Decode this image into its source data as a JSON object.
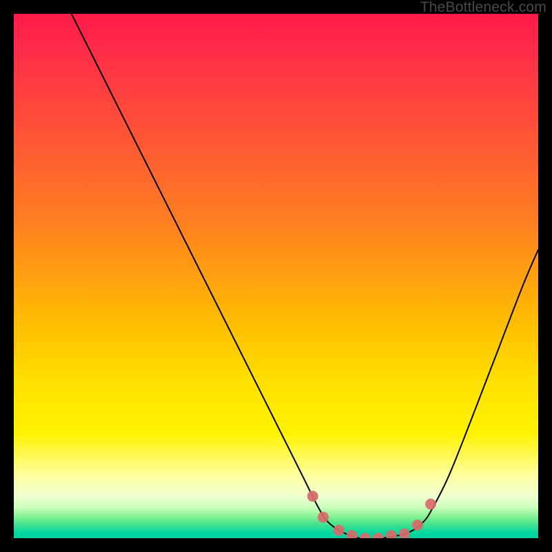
{
  "attribution": "TheBottleneck.com",
  "chart_data": {
    "type": "line",
    "title": "",
    "xlabel": "",
    "ylabel": "",
    "xlim": [
      0,
      100
    ],
    "ylim": [
      0,
      100
    ],
    "grid": false,
    "background_gradient": {
      "orientation": "vertical",
      "stops": [
        {
          "pos": 0.0,
          "color": "#ff1a4a"
        },
        {
          "pos": 0.15,
          "color": "#ff4040"
        },
        {
          "pos": 0.4,
          "color": "#ff8020"
        },
        {
          "pos": 0.6,
          "color": "#ffc000"
        },
        {
          "pos": 0.8,
          "color": "#fff200"
        },
        {
          "pos": 0.92,
          "color": "#f0ffd0"
        },
        {
          "pos": 0.96,
          "color": "#80f090"
        },
        {
          "pos": 1.0,
          "color": "#00d0a0"
        }
      ]
    },
    "series": [
      {
        "name": "bottleneck-curve",
        "stroke": "#000000",
        "stroke_width": 2,
        "x": [
          11.0,
          15.0,
          20.0,
          25.0,
          30.0,
          35.0,
          40.0,
          45.0,
          50.0,
          55.0,
          58.0,
          60.0,
          63.0,
          66.0,
          70.0,
          75.0,
          78.0,
          80.0,
          83.0,
          87.0,
          92.0,
          97.0,
          100.0
        ],
        "y": [
          100.0,
          92.0,
          82.0,
          72.0,
          62.0,
          52.0,
          42.0,
          32.0,
          22.0,
          12.0,
          6.0,
          3.0,
          1.0,
          0.0,
          0.0,
          1.0,
          3.0,
          6.0,
          12.0,
          22.0,
          35.0,
          48.0,
          55.0
        ]
      },
      {
        "name": "highlight-dots",
        "type": "scatter",
        "stroke": "#d86a6a",
        "stroke_width": 8,
        "x": [
          57.0,
          59.0,
          62.0,
          64.5,
          67.0,
          69.5,
          72.0,
          74.5,
          77.0,
          79.5
        ],
        "y": [
          8.0,
          4.0,
          1.5,
          0.5,
          0.0,
          0.0,
          0.5,
          0.8,
          2.5,
          6.5
        ]
      }
    ]
  }
}
